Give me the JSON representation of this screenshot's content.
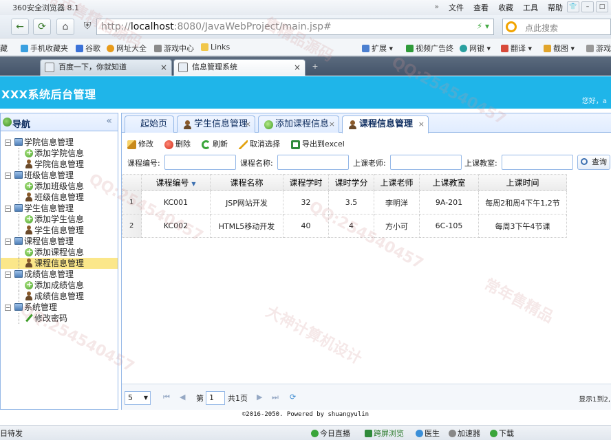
{
  "browser": {
    "title": "360安全浏览器 8.1",
    "menu": [
      "文件",
      "查看",
      "收藏",
      "工具",
      "帮助"
    ],
    "url_prefix": "http://",
    "url_host": "localhost",
    "url_rest": ":8080/JavaWebProject/main.jsp#",
    "search_placeholder": "点此搜索",
    "bookmarks_left": [
      "藏",
      "手机收藏夹",
      "谷歌",
      "网址大全",
      "游戏中心",
      "Links"
    ],
    "bookmarks_right": [
      "扩展",
      "视频广告终",
      "网银",
      "翻译",
      "截图",
      "游戏"
    ],
    "tabs": [
      "百度一下，你就知道",
      "信息管理系统"
    ]
  },
  "app": {
    "title": "XXX系统后台管理",
    "greeting": "您好，a"
  },
  "sidebar": {
    "title": "导航",
    "collapse_glyph": "«",
    "groups": [
      {
        "label": "学院信息管理",
        "children": [
          "添加学院信息",
          "学院信息管理"
        ]
      },
      {
        "label": "班级信息管理",
        "children": [
          "添加班级信息",
          "班级信息管理"
        ]
      },
      {
        "label": "学生信息管理",
        "children": [
          "添加学生信息",
          "学生信息管理"
        ]
      },
      {
        "label": "课程信息管理",
        "children": [
          "添加课程信息",
          "课程信息管理"
        ]
      },
      {
        "label": "成绩信息管理",
        "children": [
          "添加成绩信息",
          "成绩信息管理"
        ]
      },
      {
        "label": "系统管理",
        "children": [
          "修改密码"
        ]
      }
    ],
    "selected": "课程信息管理"
  },
  "tabs": [
    {
      "label": "起始页",
      "closable": false
    },
    {
      "label": "学生信息管理",
      "closable": true
    },
    {
      "label": "添加课程信息",
      "closable": true
    },
    {
      "label": "课程信息管理",
      "closable": true,
      "active": true
    }
  ],
  "toolbar": {
    "edit": "修改",
    "delete": "删除",
    "refresh": "刷新",
    "unselect": "取消选择",
    "export": "导出到excel"
  },
  "filters": {
    "course_no": "课程编号:",
    "course_name": "课程名称:",
    "teacher": "上课老师:",
    "classroom": "上课教室:",
    "query": "查询"
  },
  "grid": {
    "columns": [
      "课程编号",
      "课程名称",
      "课程学时",
      "课时学分",
      "上课老师",
      "上课教室",
      "上课时间"
    ],
    "rows": [
      {
        "n": "1",
        "cells": [
          "KC001",
          "JSP网站开发",
          "32",
          "3.5",
          "李明洋",
          "9A-201",
          "每周2和周4下午1,2节"
        ]
      },
      {
        "n": "2",
        "cells": [
          "KC002",
          "HTML5移动开发",
          "40",
          "4",
          "方小可",
          "6C-105",
          "每周3下午4节课"
        ]
      }
    ]
  },
  "pager": {
    "page_size": "5",
    "page_label_before": "第",
    "page": "1",
    "page_label_after": "共1页",
    "info": "显示1到2,"
  },
  "footer": "©2016-2050. Powered by shuangyulin",
  "status": {
    "left": "日待发",
    "right": [
      "今日直播",
      "跨屏浏览",
      "医生",
      "加速器",
      "下载"
    ]
  }
}
